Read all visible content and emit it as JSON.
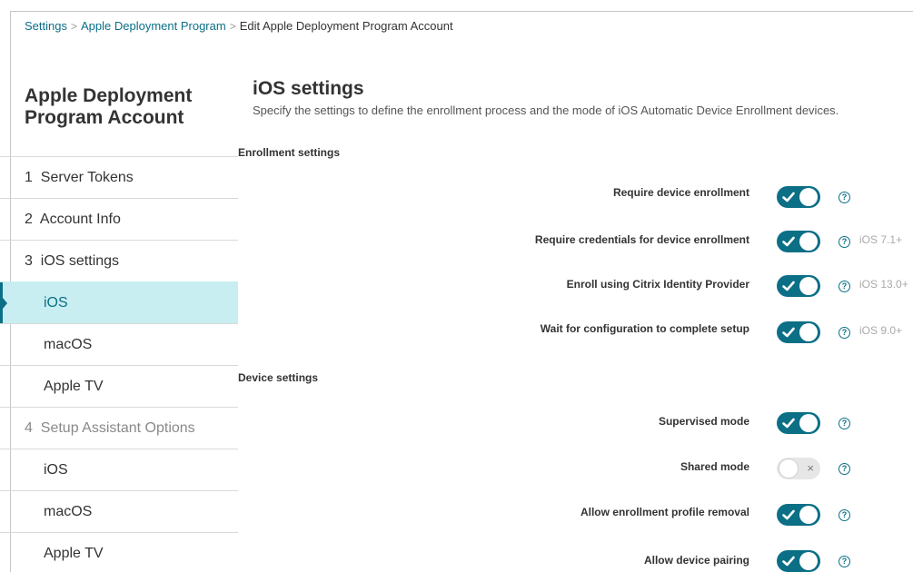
{
  "breadcrumb": {
    "items": [
      "Settings",
      "Apple Deployment Program",
      "Edit Apple Deployment Program Account"
    ],
    "separator": ">"
  },
  "sidebar": {
    "title": "Apple Deployment Program Account",
    "items": [
      {
        "label": "1  Server Tokens"
      },
      {
        "label": "2  Account Info"
      },
      {
        "label": "3  iOS settings"
      },
      {
        "label": "iOS"
      },
      {
        "label": "macOS"
      },
      {
        "label": "Apple TV"
      },
      {
        "label": "4  Setup Assistant Options"
      },
      {
        "label": "iOS"
      },
      {
        "label": "macOS"
      },
      {
        "label": "Apple TV"
      }
    ]
  },
  "main": {
    "title": "iOS settings",
    "description": "Specify the settings to define the enrollment process and the mode of iOS Automatic Device Enrollment devices.",
    "enrollment_heading": "Enrollment settings",
    "device_heading": "Device settings",
    "help_glyph": "?",
    "settings": [
      {
        "label": "Require device enrollment",
        "on": true,
        "version": ""
      },
      {
        "label": "Require credentials for device enrollment",
        "on": true,
        "version": "iOS 7.1+"
      },
      {
        "label": "Enroll using Citrix Identity Provider",
        "on": true,
        "version": "iOS 13.0+"
      },
      {
        "label": "Wait for configuration to complete setup",
        "on": true,
        "version": "iOS 9.0+"
      },
      {
        "label": "Supervised mode",
        "on": true,
        "version": ""
      },
      {
        "label": "Shared mode",
        "on": false,
        "version": ""
      },
      {
        "label": "Allow enrollment profile removal",
        "on": true,
        "version": ""
      },
      {
        "label": "Allow device pairing",
        "on": true,
        "version": ""
      }
    ]
  },
  "colors": {
    "accent": "#0b6f86",
    "active_bg": "#c8eef1",
    "toggle_off": "#e6e6e6",
    "muted_text": "#a9a9a9"
  },
  "icons": {
    "help": "question-circle-icon",
    "toggle_on": "check-icon",
    "toggle_off": "x-icon",
    "active_marker": "caret-right-icon"
  }
}
